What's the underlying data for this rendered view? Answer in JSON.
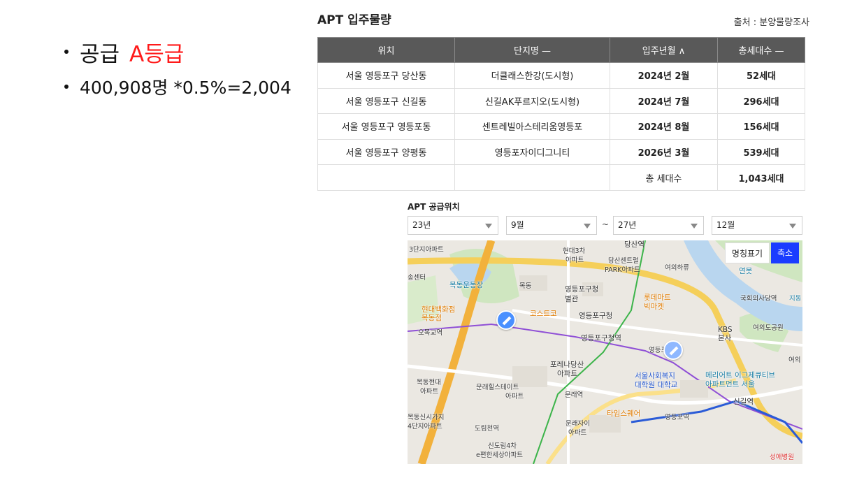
{
  "bullets": {
    "supply_prefix": "공급",
    "supply_grade": "A등급",
    "calc": "400,908명 *0.5%=2,004"
  },
  "apt_section": {
    "title": "APT 입주물량",
    "source": "출처 : 분양물량조사",
    "headers": [
      "위치",
      "단지명 —",
      "입주년월 ∧",
      "총세대수 —"
    ],
    "rows": [
      [
        "서울 영등포구 당산동",
        "더클래스한강(도시형)",
        "2024년 2월",
        "52세대"
      ],
      [
        "서울 영등포구 신길동",
        "신길AK푸르지오(도시형)",
        "2024년 7월",
        "296세대"
      ],
      [
        "서울 영등포구 영등포동",
        "센트레빌아스테리움영등포",
        "2024년 8월",
        "156세대"
      ],
      [
        "서울 영등포구 양평동",
        "영등포자이디그니티",
        "2026년 3월",
        "539세대"
      ]
    ],
    "total_label": "총 세대수",
    "total_value": "1,043세대"
  },
  "location_section": {
    "title": "APT 공급위치",
    "from_year": "23년",
    "from_month": "9월",
    "tilde": "~",
    "to_year": "27년",
    "to_month": "12월",
    "name_toggle": "명칭표기",
    "zoom_toggle": "축소"
  },
  "map_labels": {
    "l1": "목동운동장",
    "l2": "현대백화점",
    "l3": "목동점",
    "l4": "오목교역",
    "l5": "코스트코",
    "l6": "영등포구청",
    "l7": "별관",
    "l8": "영등포구청",
    "l9": "영등포구청역",
    "l10": "롯데마트",
    "l11": "빅마켓",
    "l12": "현대3차",
    "l13": "아파트",
    "l14": "당산센트럴",
    "l15": "PARK아파트",
    "l16": "당산역",
    "l17": "국회의사당역",
    "l18": "KBS",
    "l19": "본사",
    "l20": "여의도공원",
    "l21": "영등포",
    "l22": "포레나당산",
    "l23": "아파트",
    "l24": "목동현대",
    "l25": "아파트",
    "l26": "문래힐스테이트",
    "l27": "아파트",
    "l28": "문래역",
    "l29": "서울사회복지",
    "l30": "대학원 대학교",
    "l31": "메리어트 이그제큐티브",
    "l32": "아파트먼트 서울",
    "l33": "신길역",
    "l34": "타임스퀘어",
    "l35": "영등포역",
    "l36": "문래자이",
    "l37": "아파트",
    "l38": "도림천역",
    "l39": "신도림4차",
    "l40": "e편한세상아파트",
    "l41": "목동신시가지",
    "l42": "4단지아파트",
    "l43": "3단지아파트",
    "l44": "여의하류",
    "l45": "연못",
    "l46": "여의",
    "l47": "성애병원",
    "l48": "송센터",
    "l49": "목동",
    "l50": "지동"
  },
  "colors": {
    "table_header": "#595959",
    "grade_red": "#ff1a1a",
    "zoom_button": "#1a3cff",
    "marker": "#4a90ff"
  },
  "icons": {
    "dropdown": "triangle-down-icon",
    "map_marker": "hammer-marker-icon"
  }
}
